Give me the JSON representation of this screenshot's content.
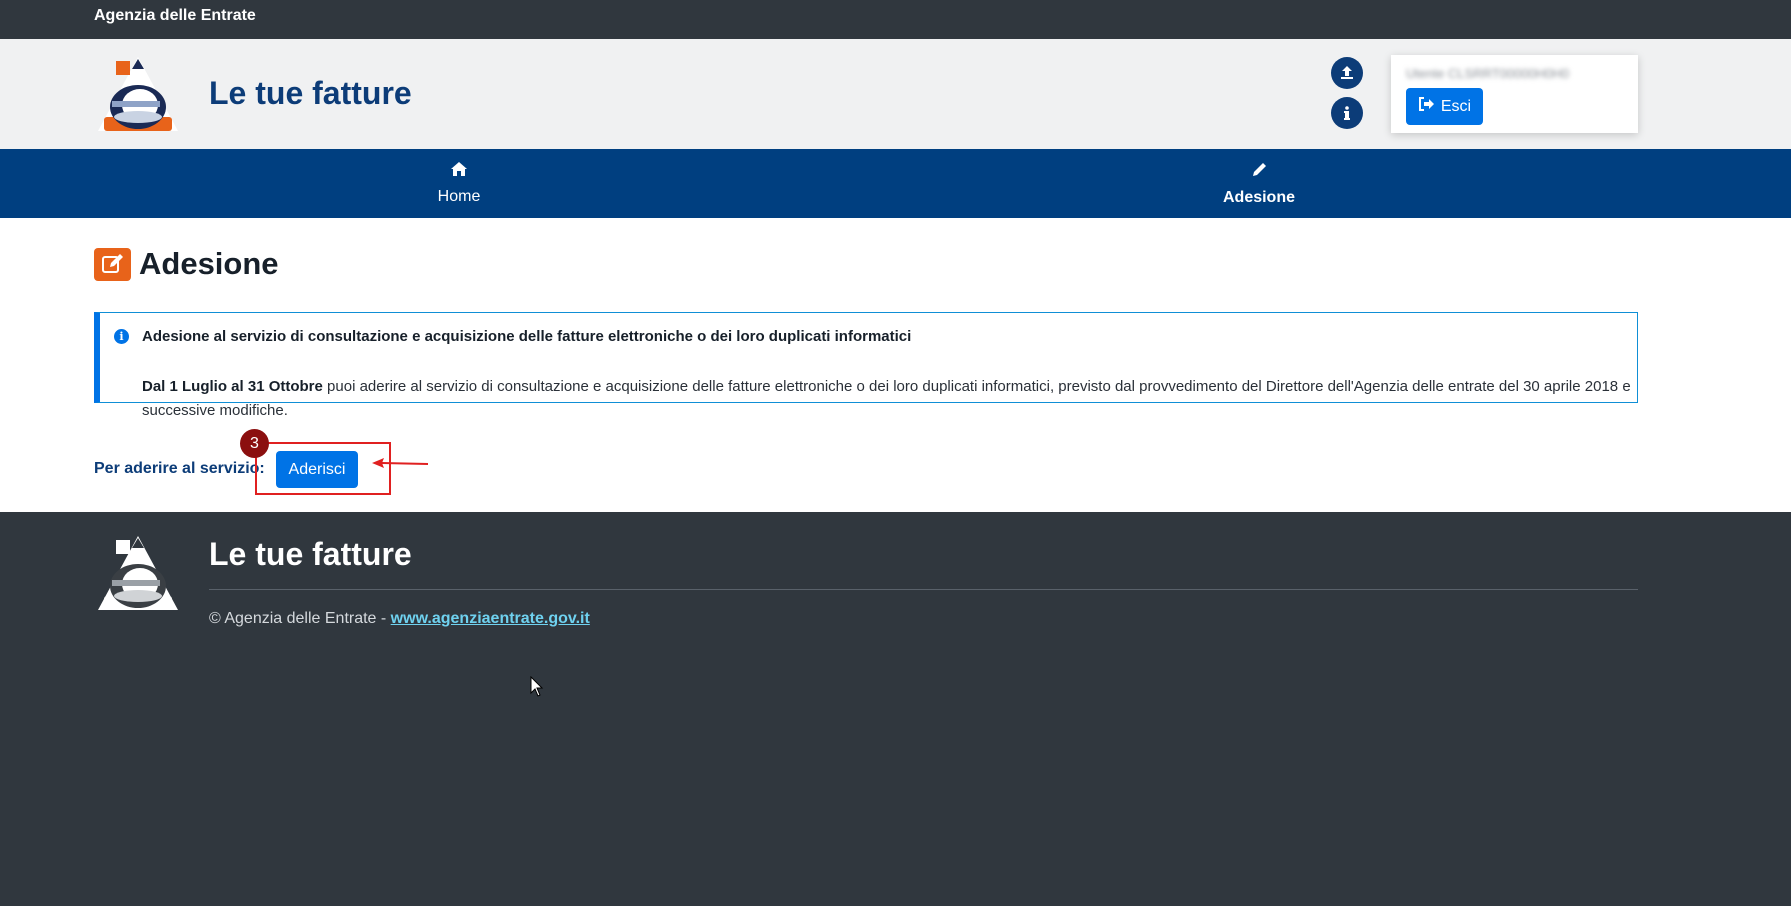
{
  "topbar": {
    "agency": "Agenzia delle Entrate"
  },
  "header": {
    "site_title": "Le tue fatture",
    "user_label": "Utente CLSRRT00000H0H0",
    "logout_label": "Esci"
  },
  "nav": {
    "items": [
      {
        "label": "Home",
        "icon": "home-icon"
      },
      {
        "label": "Adesione",
        "icon": "pencil-icon",
        "active": true
      }
    ]
  },
  "main": {
    "page_title": "Adesione",
    "alert": {
      "title": "Adesione al servizio di consultazione e acquisizione delle fatture elettroniche o dei loro duplicati informatici",
      "dates": "Dal 1 Luglio al 31 Ottobre",
      "body": " puoi aderire al servizio di consultazione e acquisizione delle fatture elettroniche o dei loro duplicati informatici, previsto dal provvedimento del Direttore dell'Agenzia delle entrate del 30 aprile 2018 e successive modifiche."
    },
    "join_label": "Per aderire al servizio:",
    "join_button": "Aderisci"
  },
  "annotation": {
    "step": "3",
    "color": "#e02020"
  },
  "footer": {
    "title": "Le tue fatture",
    "copyright": "© Agenzia delle Entrate - ",
    "link": "www.agenziaentrate.gov.it"
  },
  "colors": {
    "primary": "#0073e6",
    "navy": "#003f80",
    "dark": "#30373e",
    "orange": "#e8631a"
  }
}
